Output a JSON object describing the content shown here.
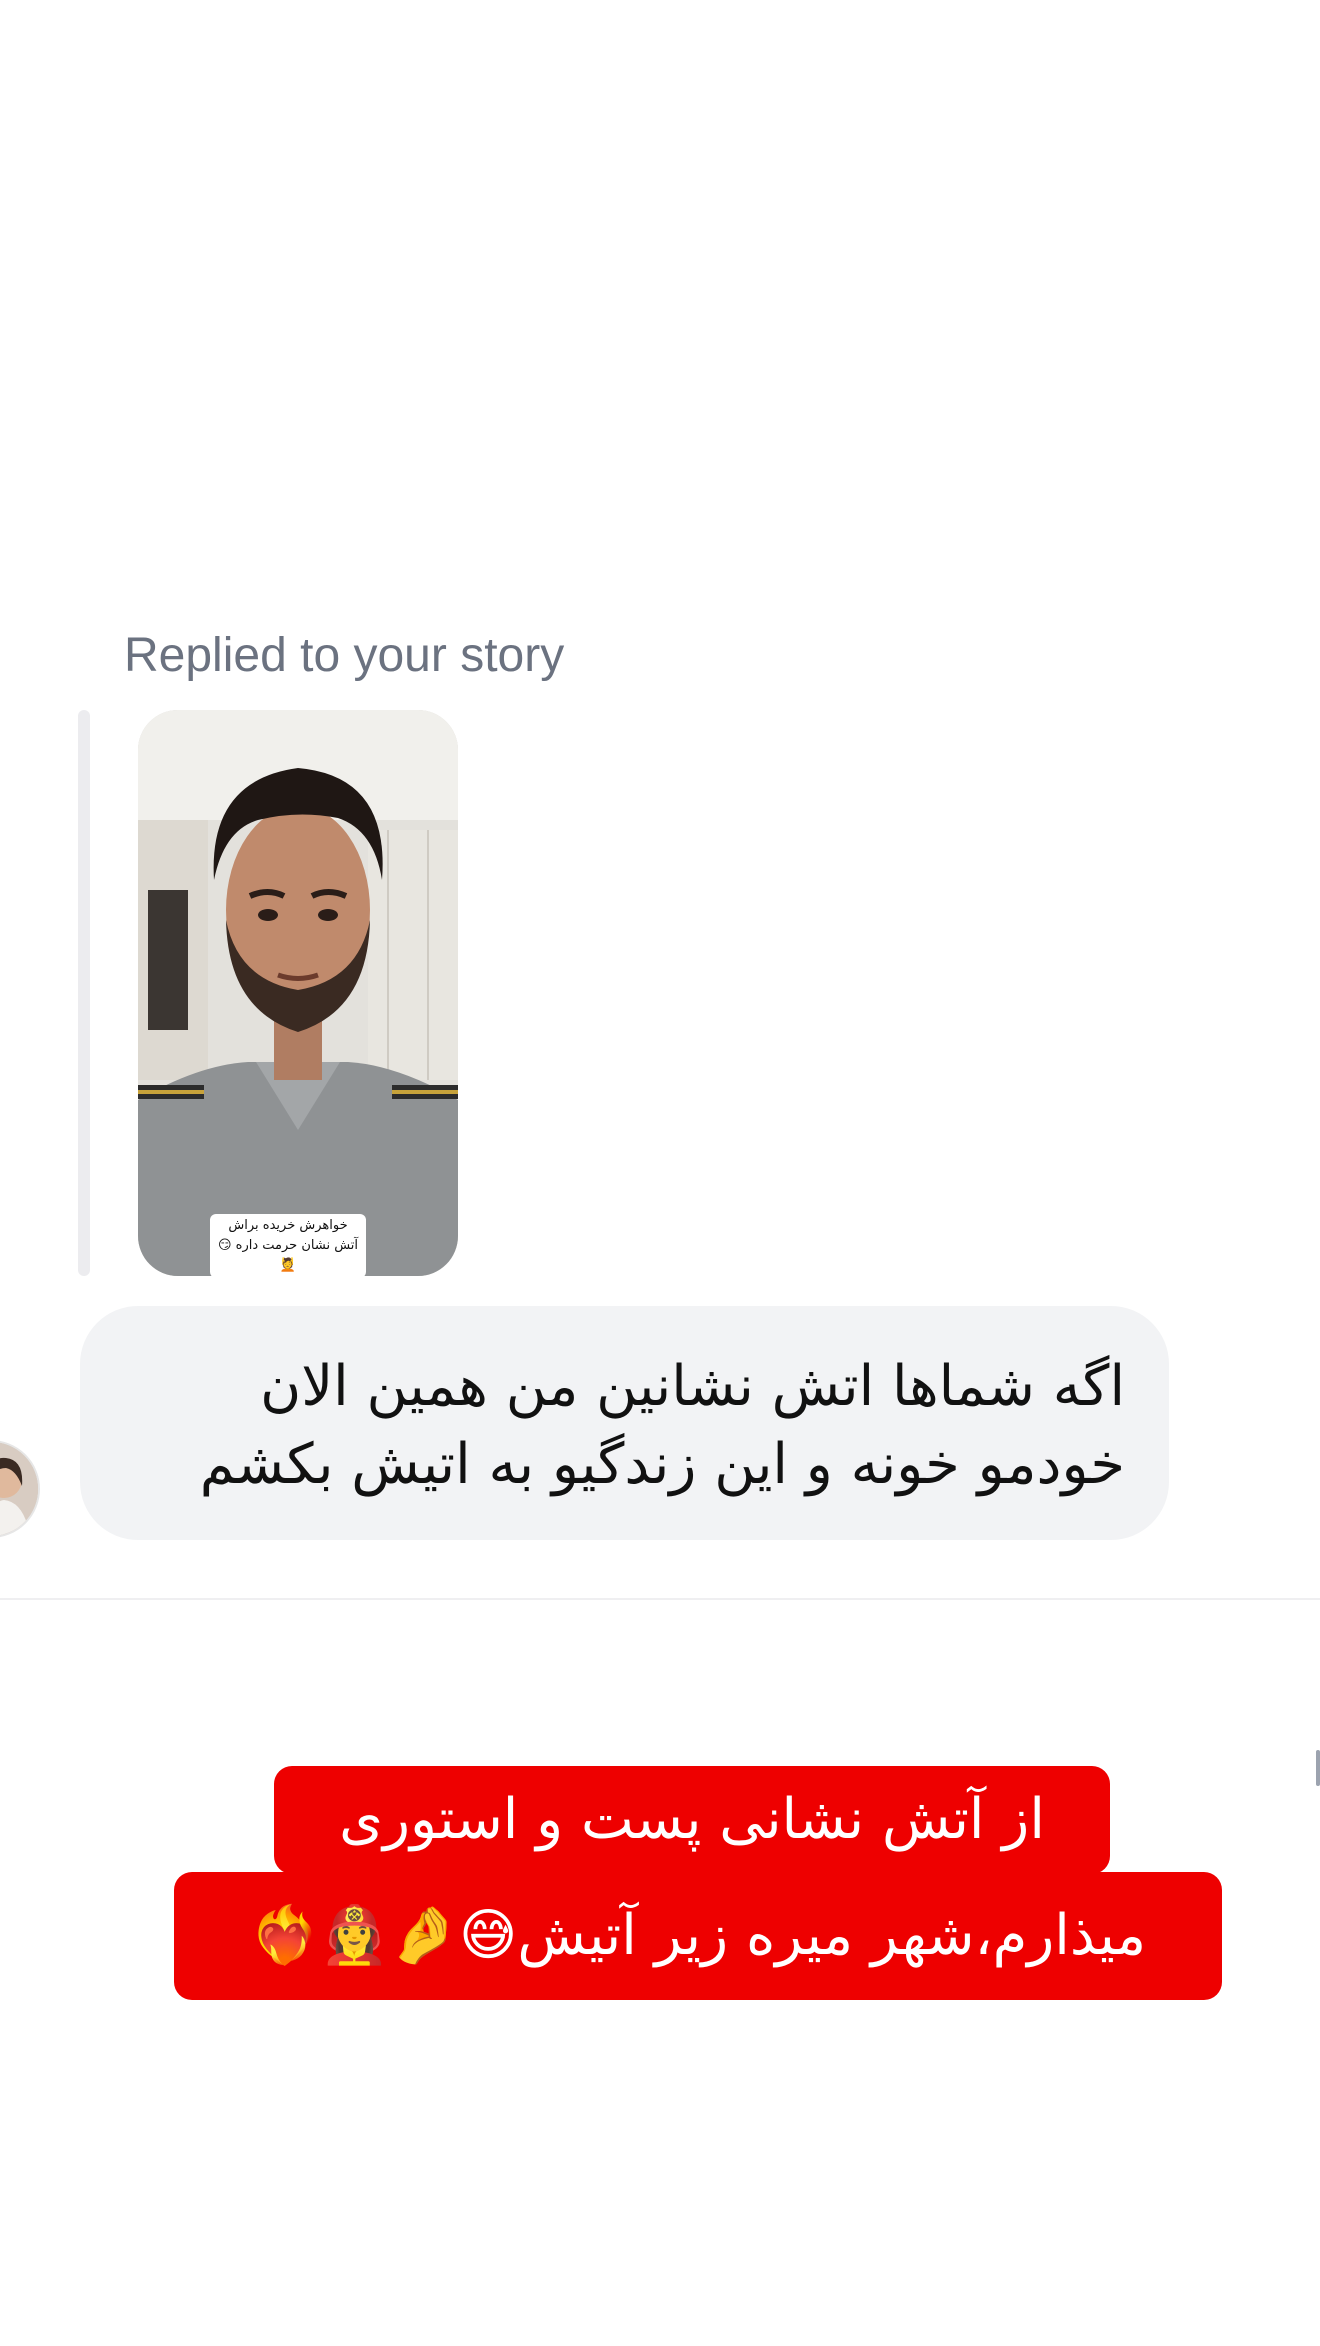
{
  "story_reply": {
    "label": "Replied to your story",
    "story_caption_line1": "خواهرش خریده براش",
    "story_caption_line2": "آتش نشان حرمت داره 😏💆"
  },
  "message": {
    "text": "اگه شماها اتش نشانین من همین الان خودمو خونه و این زندگیو به اتیش بکشم"
  },
  "overlay_caption": {
    "line1": "از آتش نشانی پست و استوری",
    "line2": "میذارم،شهر میره زیر آتیش😅🤌👩‍🚒❤️‍🔥"
  },
  "colors": {
    "bubble_bg": "#f2f3f5",
    "caption_bg": "#ee0000",
    "label_text": "#6b7280"
  }
}
